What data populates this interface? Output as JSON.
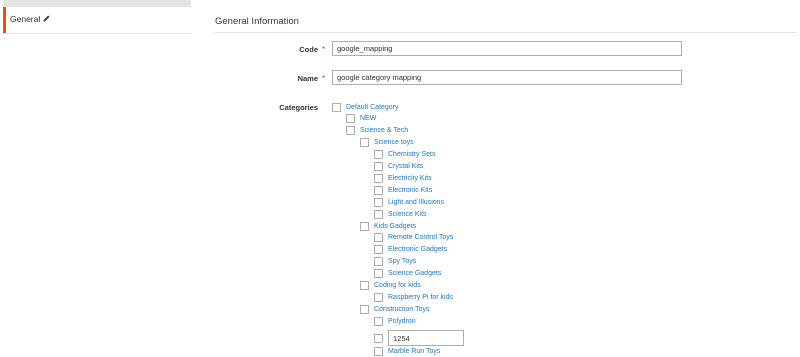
{
  "tabs": {
    "active_label": "General",
    "edit_icon": "pencil-icon"
  },
  "section": {
    "title": "General Information"
  },
  "form": {
    "code_label": "Code",
    "code_value": "google_mapping",
    "name_label": "Name",
    "name_value": "google category mapping",
    "required_mark": "*",
    "categories_label": "Categories"
  },
  "colors": {
    "accent": "#eb5202",
    "link": "#1979c3",
    "required": "#e22626"
  },
  "tree": [
    {
      "label": "Default Category",
      "level": 0
    },
    {
      "label": "NEW",
      "level": 1
    },
    {
      "label": "Science & Tech",
      "level": 1
    },
    {
      "label": "Science toys",
      "level": 2
    },
    {
      "label": "Chemistry Sets",
      "level": 3
    },
    {
      "label": "Crystal Kits",
      "level": 3
    },
    {
      "label": "Electricity Kits",
      "level": 3
    },
    {
      "label": "Electronic Kits",
      "level": 3
    },
    {
      "label": "Light and Illusions",
      "level": 3
    },
    {
      "label": "Science Kits",
      "level": 3
    },
    {
      "label": "Kids Gadgets",
      "level": 2
    },
    {
      "label": "Remote Control Toys",
      "level": 3
    },
    {
      "label": "Electronic Gadgets",
      "level": 3
    },
    {
      "label": "Spy Toys",
      "level": 3
    },
    {
      "label": "Science Gadgets",
      "level": 3
    },
    {
      "label": "Coding for kids",
      "level": 2
    },
    {
      "label": "Raspberry Pi for kids",
      "level": 3
    },
    {
      "label": "Construction Toys",
      "level": 2
    },
    {
      "label": "Polydron",
      "level": 3
    },
    {
      "input_value": "1254",
      "level": 3
    },
    {
      "label": "Marble Run Toys",
      "level": 3
    }
  ]
}
